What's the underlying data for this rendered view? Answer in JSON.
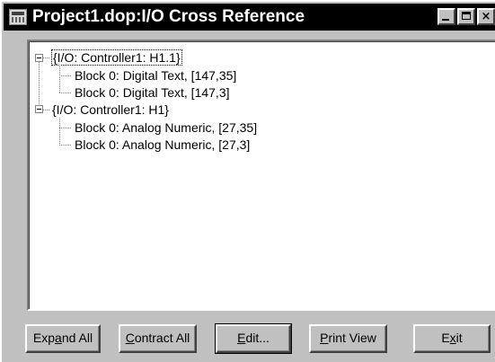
{
  "window": {
    "title": "Project1.dop:I/O Cross Reference"
  },
  "tree": {
    "nodes": [
      {
        "label": "{I/O: Controller1: H1.1}",
        "children": [
          "Block 0: Digital Text, [147,35]",
          "Block 0: Digital Text, [147,3]"
        ]
      },
      {
        "label": "{I/O: Controller1: H1}",
        "children": [
          "Block 0: Analog Numeric, [27,35]",
          "Block 0: Analog Numeric, [27,3]"
        ]
      }
    ]
  },
  "buttons": {
    "expand_all": {
      "before": "Exp",
      "mnemonic": "a",
      "after": "nd All"
    },
    "contract_all": {
      "before": "",
      "mnemonic": "C",
      "after": "ontract All"
    },
    "edit": {
      "before": "",
      "mnemonic": "E",
      "after": "dit..."
    },
    "print_view": {
      "before": "",
      "mnemonic": "P",
      "after": "rint View"
    },
    "exit": {
      "before": "E",
      "mnemonic": "x",
      "after": "it"
    }
  }
}
